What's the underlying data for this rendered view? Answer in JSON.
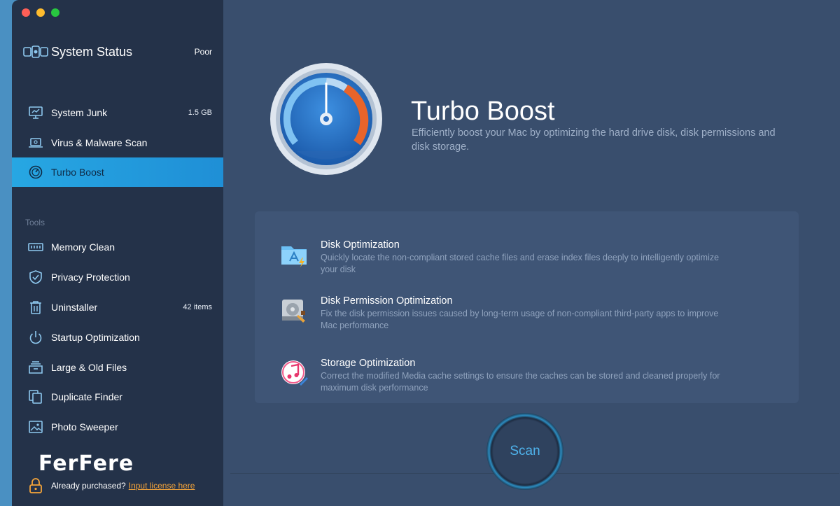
{
  "sidebar": {
    "status": {
      "title": "System Status",
      "value": "Poor"
    },
    "main_items": [
      {
        "label": "System Junk",
        "value": "1.5 GB",
        "icon": "monitor-icon"
      },
      {
        "label": "Virus & Malware Scan",
        "value": "",
        "icon": "laptop-scan-icon"
      },
      {
        "label": "Turbo Boost",
        "value": "",
        "icon": "speedometer-icon",
        "active": true
      }
    ],
    "tools_label": "Tools",
    "tools": [
      {
        "label": "Memory Clean",
        "value": "",
        "icon": "memory-chip-icon"
      },
      {
        "label": "Privacy Protection",
        "value": "",
        "icon": "shield-icon"
      },
      {
        "label": "Uninstaller",
        "value": "42 items",
        "icon": "trash-icon"
      },
      {
        "label": "Startup Optimization",
        "value": "",
        "icon": "power-icon"
      },
      {
        "label": "Large & Old Files",
        "value": "",
        "icon": "files-stack-icon"
      },
      {
        "label": "Duplicate Finder",
        "value": "",
        "icon": "duplicate-icon"
      },
      {
        "label": "Photo Sweeper",
        "value": "",
        "icon": "photo-icon"
      }
    ],
    "brand": "FerFere",
    "purchase_text": "Already purchased?",
    "purchase_link": "Input license here"
  },
  "main": {
    "title": "Turbo Boost",
    "subtitle": "Efficiently boost your Mac by optimizing the hard drive disk, disk permissions and disk storage.",
    "features": [
      {
        "title": "Disk Optimization",
        "desc": "Quickly locate the non-compliant stored cache files and erase index files deeply to intelligently optimize your disk",
        "icon": "app-folder-icon"
      },
      {
        "title": "Disk Permission Optimization",
        "desc": "Fix the disk permission issues caused by long-term usage of non-compliant third-party apps to improve Mac performance",
        "icon": "hard-drive-icon"
      },
      {
        "title": "Storage Optimization",
        "desc": "Correct the modified Media cache settings to ensure the caches can be stored and cleaned properly for maximum disk performance",
        "icon": "music-icon"
      }
    ],
    "scan_label": "Scan"
  },
  "colors": {
    "accent": "#27a7e3",
    "link": "#f4a43a",
    "sidebar_bg": "#243249",
    "main_bg": "#394e6d"
  }
}
